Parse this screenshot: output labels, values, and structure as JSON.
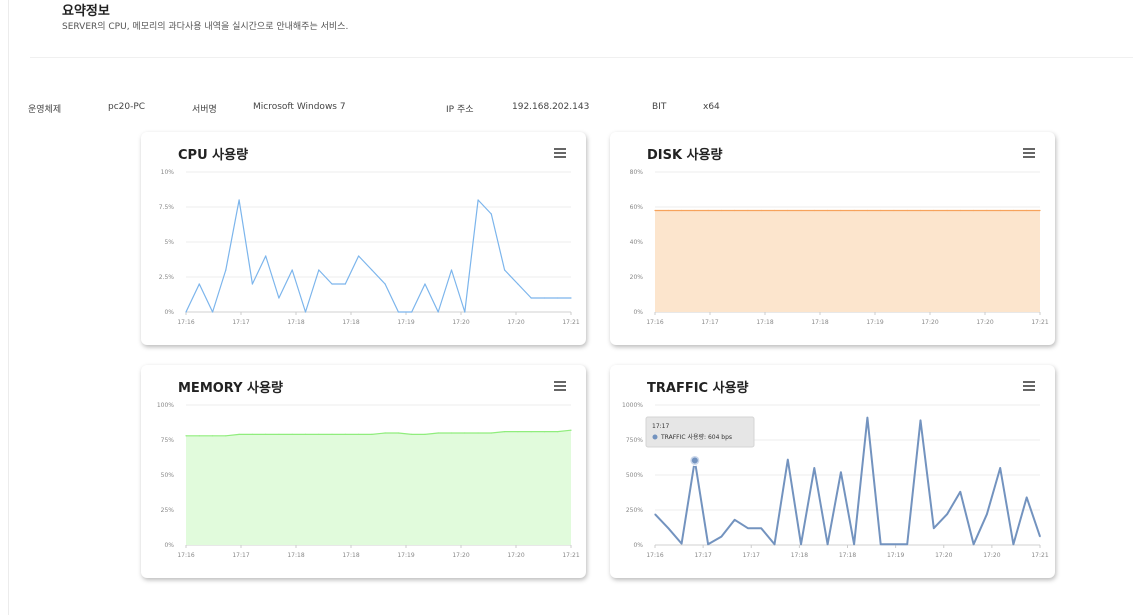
{
  "header": {
    "title": "요약정보",
    "subtitle": "SERVER의 CPU, 메모리의 과다사용 내역을 실시간으로 안내해주는 서비스."
  },
  "info": {
    "os_label": "운영체제",
    "os_value": "pc20-PC",
    "server_label": "서버명",
    "server_value": "Microsoft Windows 7",
    "ip_label": "IP 주소",
    "ip_value": "192.168.202.143",
    "bit_label": "BIT",
    "bit_value": "x64"
  },
  "menu_icon": "hamburger-menu-icon",
  "chart_data": [
    {
      "id": "cpu",
      "type": "line",
      "title": "CPU 사용량",
      "color": "#7cb5ec",
      "fill": false,
      "ylim": [
        0,
        10
      ],
      "y_ticks": [
        "0%",
        "2.5%",
        "5%",
        "7.5%",
        "10%"
      ],
      "x_ticks": [
        "17:16",
        "17:17",
        "17:18",
        "17:18",
        "17:19",
        "17:20",
        "17:20",
        "17:21"
      ],
      "series": [
        {
          "values": [
            0,
            2,
            0,
            3,
            8,
            2,
            4,
            1,
            3,
            0,
            3,
            2,
            2,
            4,
            3,
            2,
            0,
            0,
            2,
            0,
            3,
            0,
            8,
            7,
            3,
            2,
            1,
            1,
            1,
            1
          ]
        }
      ]
    },
    {
      "id": "disk",
      "type": "area",
      "title": "DISK 사용량",
      "color": "#f7a35c",
      "fill_color": "#fce5cd",
      "fill": true,
      "ylim": [
        0,
        80
      ],
      "y_ticks": [
        "0%",
        "20%",
        "40%",
        "60%",
        "80%"
      ],
      "x_ticks": [
        "17:16",
        "17:17",
        "17:18",
        "17:18",
        "17:19",
        "17:20",
        "17:20",
        "17:21"
      ],
      "series": [
        {
          "values": [
            58,
            58,
            58,
            58,
            58,
            58,
            58,
            58,
            58,
            58,
            58,
            58,
            58,
            58,
            58,
            58,
            58,
            58,
            58,
            58,
            58,
            58,
            58,
            58,
            58,
            58,
            58,
            58,
            58,
            58
          ]
        }
      ]
    },
    {
      "id": "memory",
      "type": "area",
      "title": "MEMORY 사용량",
      "color": "#90ed7d",
      "fill_color": "#e1fbdc",
      "fill": true,
      "ylim": [
        0,
        100
      ],
      "y_ticks": [
        "0%",
        "25%",
        "50%",
        "75%",
        "100%"
      ],
      "x_ticks": [
        "17:16",
        "17:17",
        "17:18",
        "17:18",
        "17:19",
        "17:20",
        "17:20",
        "17:21"
      ],
      "series": [
        {
          "values": [
            78,
            78,
            78,
            78,
            79,
            79,
            79,
            79,
            79,
            79,
            79,
            79,
            79,
            79,
            79,
            80,
            80,
            79,
            79,
            80,
            80,
            80,
            80,
            80,
            81,
            81,
            81,
            81,
            81,
            82
          ]
        }
      ]
    },
    {
      "id": "traffic",
      "type": "line",
      "title": "TRAFFIC 사용량",
      "color": "#7393bf",
      "fill": false,
      "ylim": [
        0,
        1000
      ],
      "y_ticks": [
        "0%",
        "250%",
        "500%",
        "750%",
        "1000%"
      ],
      "x_ticks": [
        "17:16",
        "17:17",
        "17:17",
        "17:18",
        "17:18",
        "17:19",
        "17:20",
        "17:20",
        "17:21"
      ],
      "series": [
        {
          "name": "TRAFFIC 사용량",
          "values": [
            220,
            120,
            10,
            604,
            5,
            60,
            180,
            120,
            120,
            5,
            610,
            5,
            550,
            5,
            520,
            5,
            910,
            5,
            5,
            5,
            890,
            120,
            220,
            380,
            5,
            220,
            550,
            5,
            340,
            60
          ]
        }
      ],
      "tooltip": {
        "index": 3,
        "time": "17:17",
        "label": "TRAFFIC 사용량: 604 bps"
      }
    }
  ]
}
